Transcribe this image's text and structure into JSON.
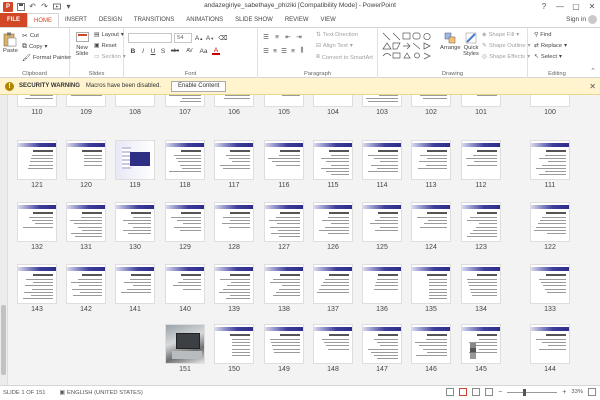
{
  "window": {
    "title": "andazegiriye_sabethaye_phiziki [Compatibility Mode] - PowerPoint",
    "app_icon": "P",
    "controls": [
      "?",
      "—",
      "▢",
      "✕"
    ]
  },
  "qat": {
    "icons": [
      "save-icon",
      "undo-icon",
      "redo-icon",
      "start-from-beginning-icon",
      "customize-qat-icon"
    ]
  },
  "tabs": [
    {
      "label": "FILE"
    },
    {
      "label": "HOME"
    },
    {
      "label": "INSERT"
    },
    {
      "label": "DESIGN"
    },
    {
      "label": "TRANSITIONS"
    },
    {
      "label": "ANIMATIONS"
    },
    {
      "label": "SLIDE SHOW"
    },
    {
      "label": "REVIEW"
    },
    {
      "label": "VIEW"
    }
  ],
  "account": {
    "label": "Sign in"
  },
  "ribbon": {
    "clipboard": {
      "label": "Clipboard",
      "paste": "Paste",
      "cut": "Cut",
      "copy": "Copy",
      "format_painter": "Format Painter"
    },
    "slides": {
      "label": "Slides",
      "new_slide": "New Slide",
      "layout": "Layout",
      "reset": "Reset",
      "section": "Section"
    },
    "font": {
      "label": "Font",
      "font_name": "",
      "font_size": "54",
      "buttons": [
        "B",
        "I",
        "U",
        "S",
        "abc",
        "AV",
        "Aa",
        "A"
      ]
    },
    "paragraph": {
      "label": "Paragraph",
      "text_direction": "Text Direction",
      "align_text": "Align Text",
      "convert_smartart": "Convert to SmartArt"
    },
    "drawing": {
      "label": "Drawing",
      "arrange": "Arrange",
      "quick_styles": "Quick Styles",
      "shape_fill": "Shape Fill",
      "shape_outline": "Shape Outline",
      "shape_effects": "Shape Effects"
    },
    "editing": {
      "label": "Editing",
      "find": "Find",
      "replace": "Replace",
      "select": "Select"
    }
  },
  "security": {
    "title": "SECURITY WARNING",
    "message": "Macros have been disabled.",
    "button": "Enable Content"
  },
  "slides_rows": [
    [
      "110",
      "109",
      "108",
      "107",
      "106",
      "105",
      "104",
      "103",
      "102",
      "101",
      "100"
    ],
    [
      "121",
      "120",
      "119",
      "118",
      "117",
      "116",
      "115",
      "114",
      "113",
      "112",
      "111"
    ],
    [
      "132",
      "131",
      "130",
      "129",
      "128",
      "127",
      "126",
      "125",
      "124",
      "123",
      "122"
    ],
    [
      "143",
      "142",
      "141",
      "140",
      "139",
      "138",
      "137",
      "136",
      "135",
      "134",
      "133"
    ],
    [
      "",
      "",
      "",
      "151",
      "150",
      "149",
      "148",
      "147",
      "146",
      "145",
      "144"
    ]
  ],
  "status": {
    "slide_info": "SLIDE 1 OF 151",
    "language": "ENGLISH (UNITED STATES)",
    "zoom": "33%",
    "zoom_level": 0.33
  }
}
